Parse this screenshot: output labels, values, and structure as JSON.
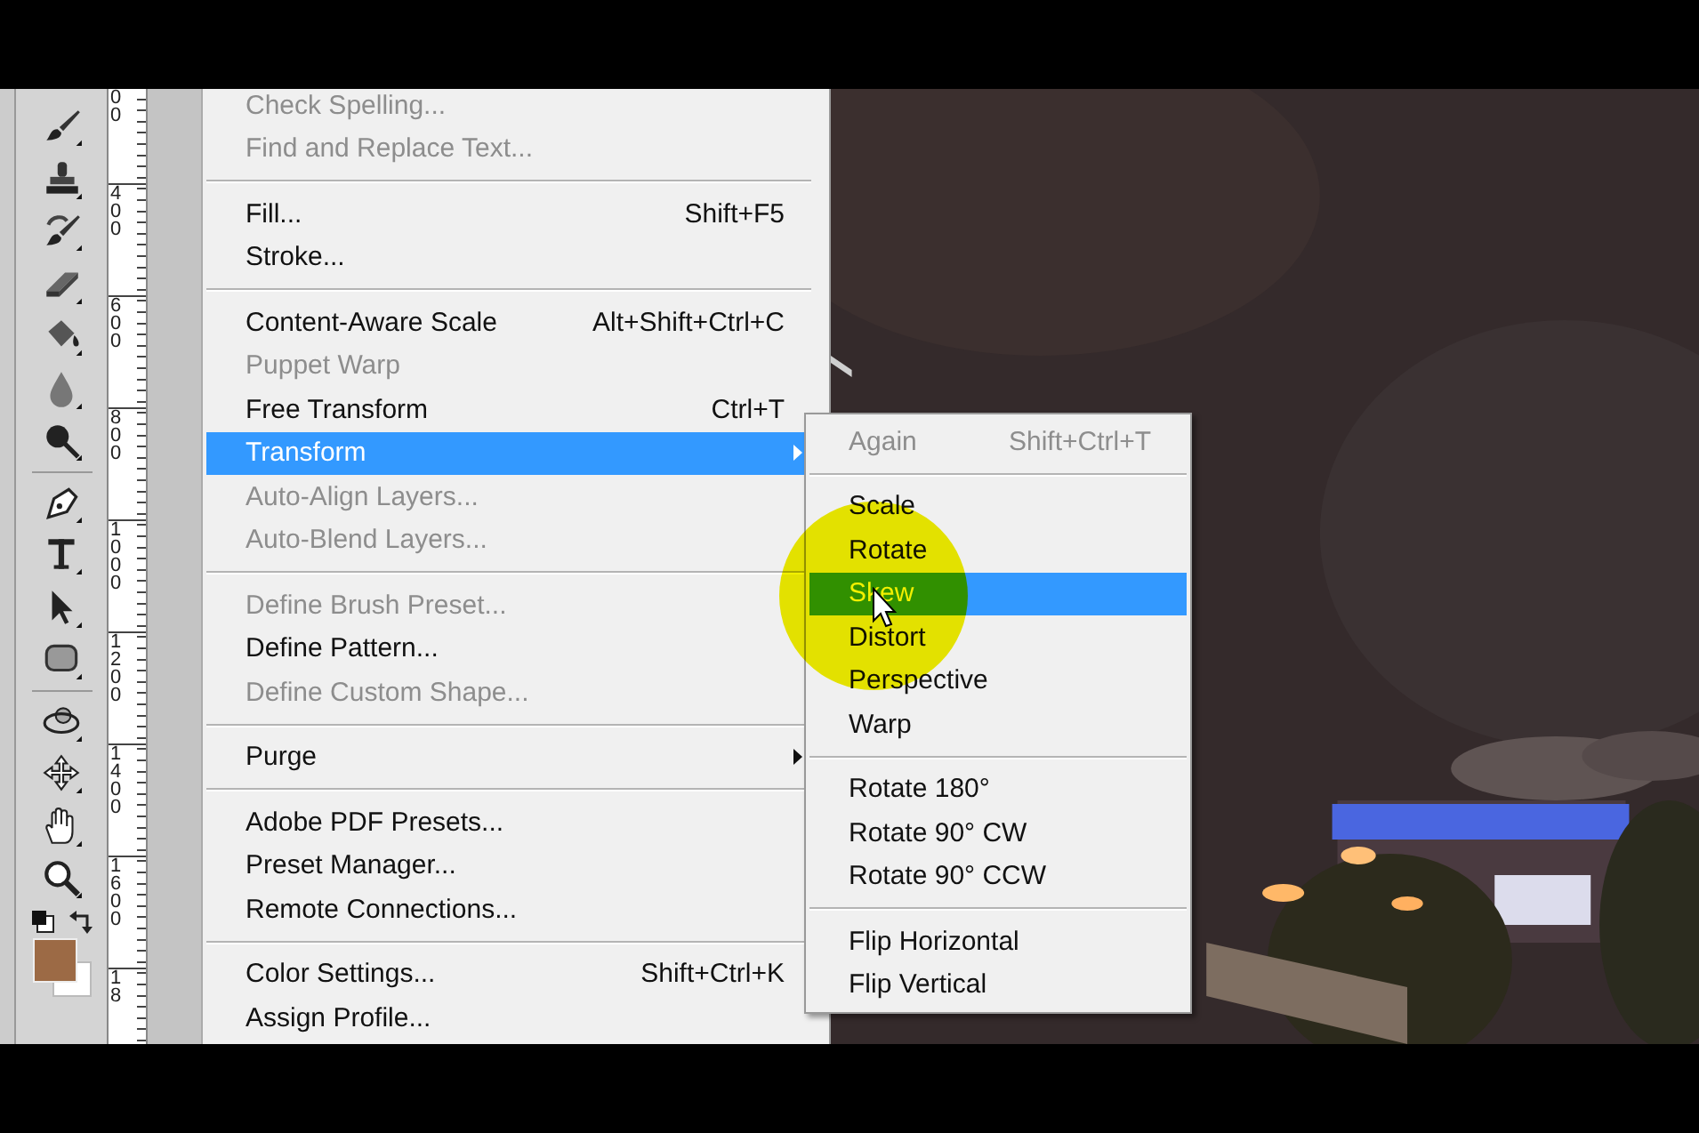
{
  "ruler": {
    "labels": [
      "00",
      "400",
      "600",
      "800",
      "1000",
      "1200",
      "1400",
      "1600",
      "18"
    ]
  },
  "edit_menu": {
    "items": [
      {
        "kind": "item",
        "label": "Check Spelling...",
        "disabled": true,
        "selected": false,
        "submenu": false
      },
      {
        "kind": "item",
        "label": "Find and Replace Text...",
        "disabled": true,
        "selected": false,
        "submenu": false
      },
      {
        "kind": "separator"
      },
      {
        "kind": "item",
        "label": "Fill...",
        "shortcut": "Shift+F5",
        "disabled": false,
        "selected": false,
        "submenu": false
      },
      {
        "kind": "item",
        "label": "Stroke...",
        "disabled": false,
        "selected": false,
        "submenu": false
      },
      {
        "kind": "separator"
      },
      {
        "kind": "item",
        "label": "Content-Aware Scale",
        "shortcut": "Alt+Shift+Ctrl+C",
        "disabled": false,
        "selected": false,
        "submenu": false
      },
      {
        "kind": "item",
        "label": "Puppet Warp",
        "disabled": true,
        "selected": false,
        "submenu": false
      },
      {
        "kind": "item",
        "label": "Free Transform",
        "shortcut": "Ctrl+T",
        "disabled": false,
        "selected": false,
        "submenu": false
      },
      {
        "kind": "item",
        "label": "Transform",
        "disabled": false,
        "selected": true,
        "submenu": true
      },
      {
        "kind": "item",
        "label": "Auto-Align Layers...",
        "disabled": true,
        "selected": false,
        "submenu": false
      },
      {
        "kind": "item",
        "label": "Auto-Blend Layers...",
        "disabled": true,
        "selected": false,
        "submenu": false
      },
      {
        "kind": "separator"
      },
      {
        "kind": "item",
        "label": "Define Brush Preset...",
        "disabled": true,
        "selected": false,
        "submenu": false
      },
      {
        "kind": "item",
        "label": "Define Pattern...",
        "disabled": false,
        "selected": false,
        "submenu": false
      },
      {
        "kind": "item",
        "label": "Define Custom Shape...",
        "disabled": true,
        "selected": false,
        "submenu": false
      },
      {
        "kind": "separator"
      },
      {
        "kind": "item",
        "label": "Purge",
        "disabled": false,
        "selected": false,
        "submenu": true
      },
      {
        "kind": "separator"
      },
      {
        "kind": "item",
        "label": "Adobe PDF Presets...",
        "disabled": false,
        "selected": false,
        "submenu": false
      },
      {
        "kind": "item",
        "label": "Preset Manager...",
        "disabled": false,
        "selected": false,
        "submenu": false
      },
      {
        "kind": "item",
        "label": "Remote Connections...",
        "disabled": false,
        "selected": false,
        "submenu": false
      },
      {
        "kind": "separator"
      },
      {
        "kind": "item",
        "label": "Color Settings...",
        "shortcut": "Shift+Ctrl+K",
        "disabled": false,
        "selected": false,
        "submenu": false
      },
      {
        "kind": "item",
        "label": "Assign Profile...",
        "disabled": false,
        "selected": false,
        "submenu": false
      }
    ]
  },
  "transform_submenu": {
    "items": [
      {
        "kind": "item",
        "label": "Again",
        "shortcut": "Shift+Ctrl+T",
        "disabled": true,
        "selected": false
      },
      {
        "kind": "separator"
      },
      {
        "kind": "item",
        "label": "Scale",
        "disabled": false,
        "selected": false
      },
      {
        "kind": "item",
        "label": "Rotate",
        "disabled": false,
        "selected": false
      },
      {
        "kind": "item",
        "label": "Skew",
        "disabled": false,
        "selected": true
      },
      {
        "kind": "item",
        "label": "Distort",
        "disabled": false,
        "selected": false
      },
      {
        "kind": "item",
        "label": "Perspective",
        "disabled": false,
        "selected": false
      },
      {
        "kind": "item",
        "label": "Warp",
        "disabled": false,
        "selected": false
      },
      {
        "kind": "separator"
      },
      {
        "kind": "item",
        "label": "Rotate 180°",
        "disabled": false,
        "selected": false
      },
      {
        "kind": "item",
        "label": "Rotate 90° CW",
        "disabled": false,
        "selected": false
      },
      {
        "kind": "item",
        "label": "Rotate 90° CCW",
        "disabled": false,
        "selected": false
      },
      {
        "kind": "separator"
      },
      {
        "kind": "item",
        "label": "Flip Horizontal",
        "disabled": false,
        "selected": false
      },
      {
        "kind": "item",
        "label": "Flip Vertical",
        "disabled": false,
        "selected": false
      }
    ]
  }
}
